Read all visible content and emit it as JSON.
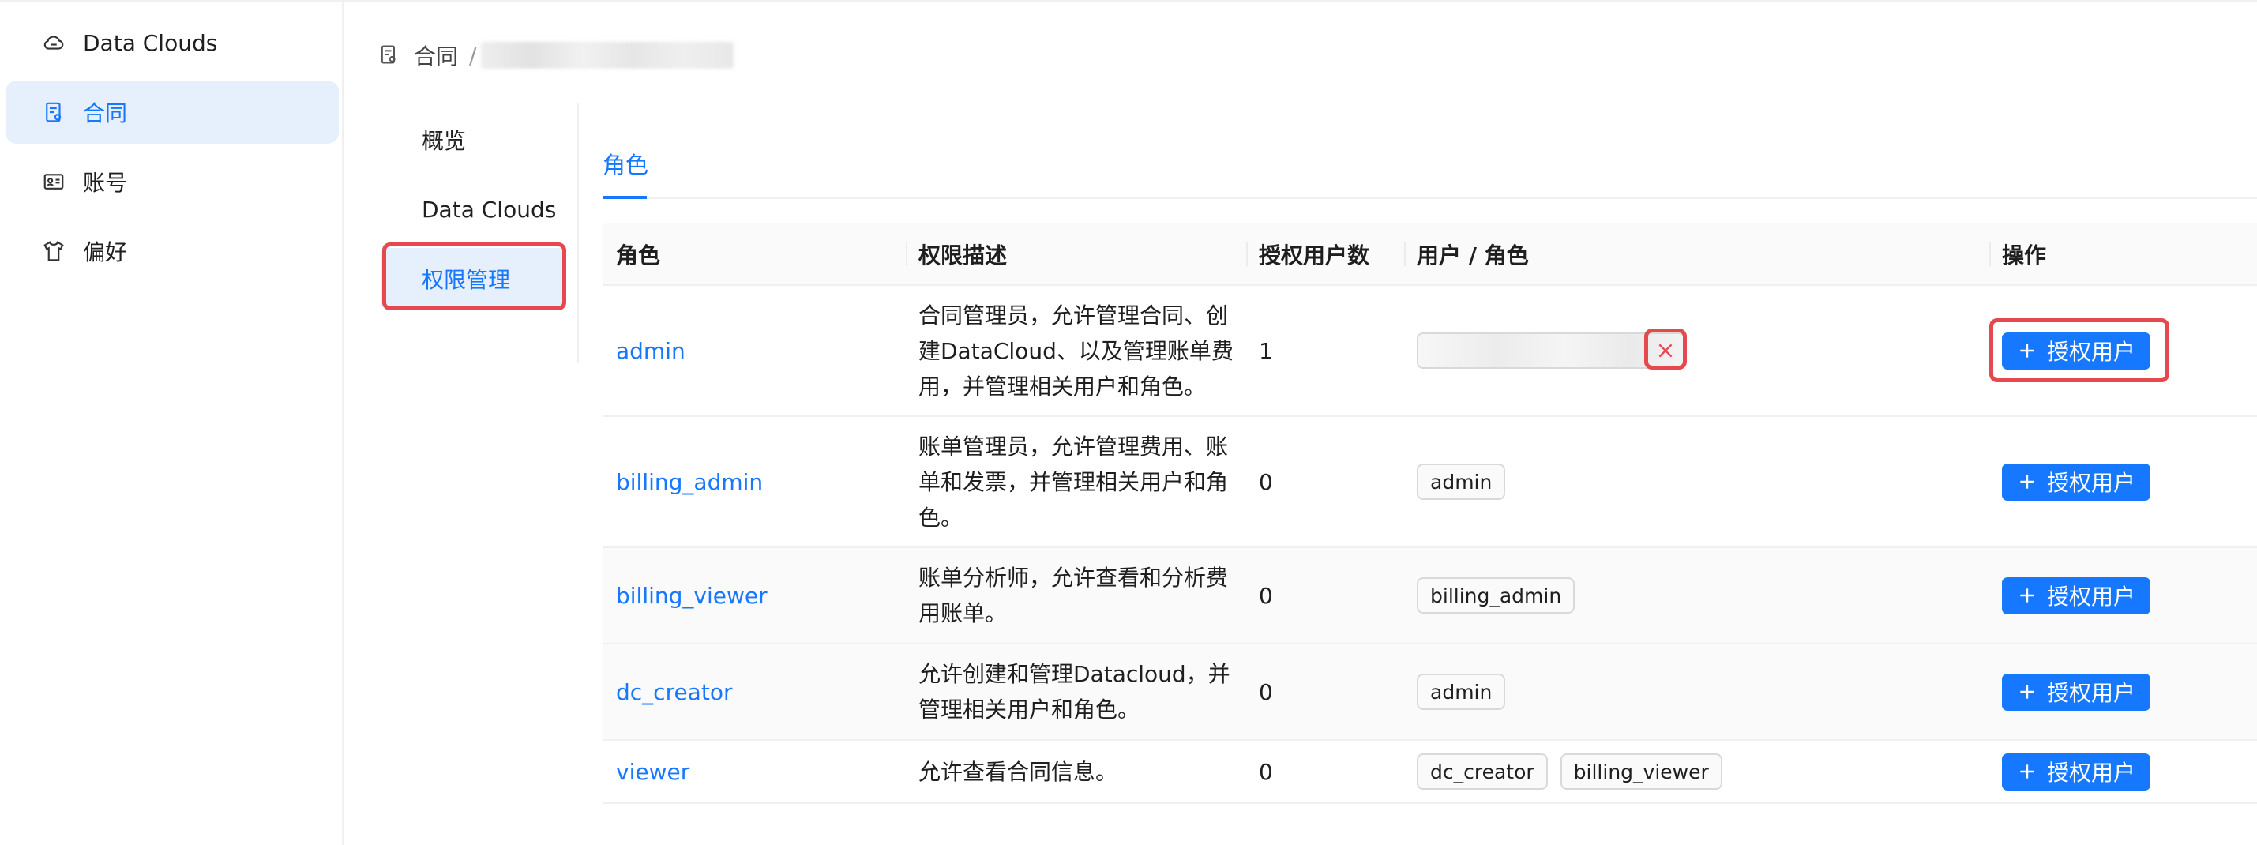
{
  "sidebar": {
    "items": [
      {
        "label": "Data Clouds",
        "icon": "cloud-icon",
        "active": false
      },
      {
        "label": "合同",
        "icon": "contract-icon",
        "active": true
      },
      {
        "label": "账号",
        "icon": "id-card-icon",
        "active": false
      },
      {
        "label": "偏好",
        "icon": "shirt-icon",
        "active": false
      }
    ]
  },
  "breadcrumb": {
    "root": "合同",
    "separator": "/"
  },
  "submenu": {
    "items": [
      {
        "label": "概览"
      },
      {
        "label": "Data Clouds"
      },
      {
        "label": "权限管理"
      }
    ]
  },
  "tabs": [
    {
      "label": "角色"
    }
  ],
  "table": {
    "headers": [
      "角色",
      "权限描述",
      "授权用户数",
      "用户 / 角色",
      "操作"
    ],
    "rows": [
      {
        "role": "admin",
        "desc": "合同管理员，允许管理合同、创建DataCloud、以及管理账单费用，并管理相关用户和角色。",
        "count": "1",
        "tags": [],
        "action": "授权用户"
      },
      {
        "role": "billing_admin",
        "desc": "账单管理员，允许管理费用、账单和发票，并管理相关用户和角色。",
        "count": "0",
        "tags": [
          "admin"
        ],
        "action": "授权用户"
      },
      {
        "role": "billing_viewer",
        "desc": "账单分析师，允许查看和分析费用账单。",
        "count": "0",
        "tags": [
          "billing_admin"
        ],
        "action": "授权用户"
      },
      {
        "role": "dc_creator",
        "desc": "允许创建和管理Datacloud，并管理相关用户和角色。",
        "count": "0",
        "tags": [
          "admin"
        ],
        "action": "授权用户"
      },
      {
        "role": "viewer",
        "desc": "允许查看合同信息。",
        "count": "0",
        "tags": [
          "dc_creator",
          "billing_viewer"
        ],
        "action": "授权用户"
      }
    ]
  },
  "colors": {
    "accent": "#1677ff",
    "highlight": "#e5484d",
    "active_bg": "#e6f0fc"
  }
}
